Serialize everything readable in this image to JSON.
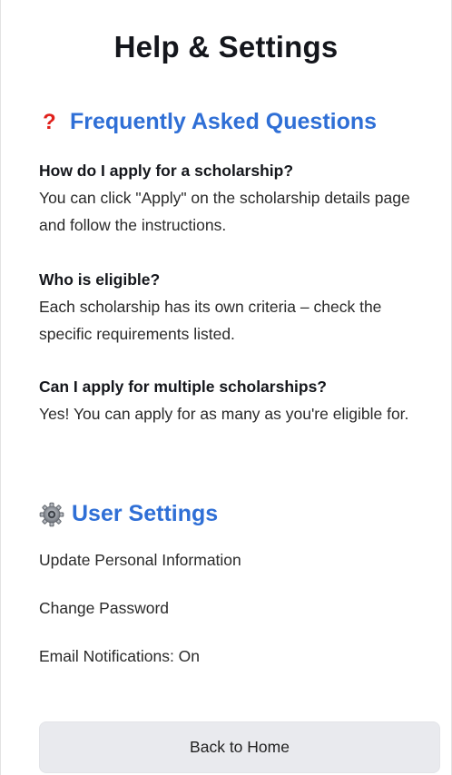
{
  "page": {
    "title": "Help & Settings"
  },
  "faq": {
    "icon": "question-mark-icon",
    "icon_glyph": "?",
    "icon_color": "#e0201b",
    "heading": "Frequently Asked Questions",
    "items": [
      {
        "question": "How do I apply for a scholarship?",
        "answer": "You can click \"Apply\" on the scholarship details page and follow the instructions."
      },
      {
        "question": "Who is eligible?",
        "answer": "Each scholarship has its own criteria – check the specific requirements listed."
      },
      {
        "question": "Can I apply for multiple scholarships?",
        "answer": "Yes! You can apply for as many as you're eligible for."
      }
    ]
  },
  "settings": {
    "icon": "gear-icon",
    "heading": "User Settings",
    "items": [
      {
        "label": "Update Personal Information"
      },
      {
        "label": "Change Password"
      },
      {
        "label": "Email Notifications: On"
      }
    ]
  },
  "footer": {
    "back_label": "Back to Home"
  },
  "colors": {
    "accent": "#2f6fd6",
    "button_bg": "#e9eaee"
  }
}
